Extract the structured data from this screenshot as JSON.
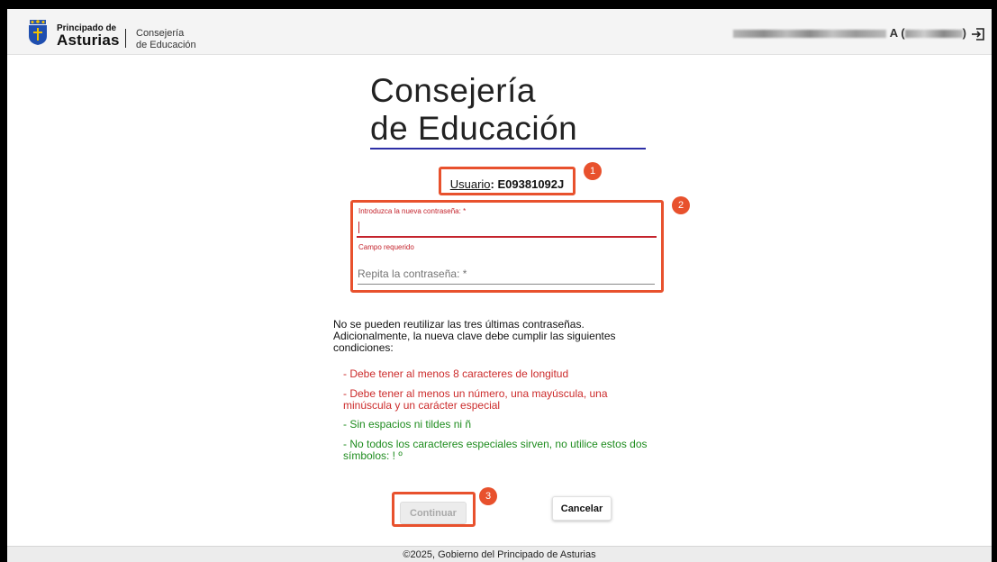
{
  "header": {
    "brand_top": "Principado de",
    "brand_main": "Asturias",
    "brand_sub_1": "Consejería",
    "brand_sub_2": "de Educación",
    "user_suffix": "A (",
    "user_end": ")"
  },
  "page": {
    "title_line1": "Consejería",
    "title_line2": "de Educación"
  },
  "user": {
    "label": "Usuario",
    "separator": ":",
    "value": "E09381092J"
  },
  "form": {
    "new_password_label": "Introduzca la nueva contraseña: *",
    "new_password_value": "",
    "error": "Campo requerido",
    "repeat_password_placeholder": "Repita la contraseña: *"
  },
  "rules": {
    "intro": "No se pueden reutilizar las tres últimas contraseñas. Adicionalmente, la nueva clave debe cumplir las siguientes condiciones:",
    "items": [
      "- Debe tener al menos 8 caracteres de longitud",
      "- Debe tener al menos un número, una mayúscula, una minúscula y un carácter especial",
      "- Sin espacios ni tildes ni ñ",
      "- No todos los caracteres especiales sirven, no utilice estos dos símbolos: ! º"
    ]
  },
  "buttons": {
    "continue": "Continuar",
    "cancel": "Cancelar"
  },
  "annotations": {
    "marker_1": "1",
    "marker_2": "2",
    "marker_3": "3"
  },
  "footer": {
    "text": "©2025, Gobierno del Principado de Asturias"
  },
  "colors": {
    "accent": "#2d2fa6",
    "error": "#c4232c",
    "success": "#1e8c1e",
    "annotation": "#e8512d"
  }
}
